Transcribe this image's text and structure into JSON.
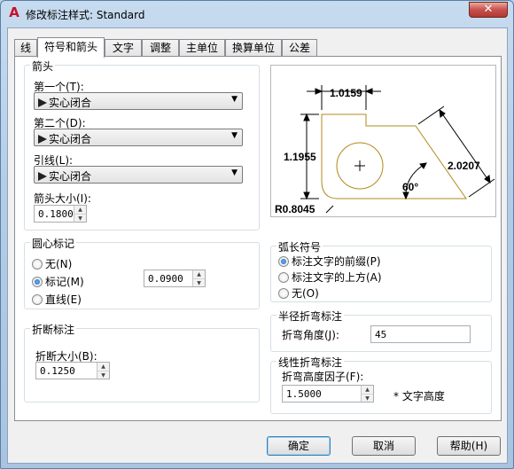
{
  "window": {
    "title": "修改标注样式: Standard",
    "close": "✕"
  },
  "tabs": [
    "线",
    "符号和箭头",
    "文字",
    "调整",
    "主单位",
    "换算单位",
    "公差"
  ],
  "arrows": {
    "legend": "箭头",
    "first_label": "第一个(T):",
    "first_value": "实心闭合",
    "second_label": "第二个(D):",
    "second_value": "实心闭合",
    "leader_label": "引线(L):",
    "leader_value": "实心闭合",
    "size_label": "箭头大小(I):",
    "size_value": "0.1800"
  },
  "center_marks": {
    "legend": "圆心标记",
    "none": "无(N)",
    "mark": "标记(M)",
    "line": "直线(E)",
    "value": "0.0900",
    "selected": "mark"
  },
  "break": {
    "legend": "折断标注",
    "size_label": "折断大小(B):",
    "size_value": "0.1250"
  },
  "arc_length": {
    "legend": "弧长符号",
    "prefix": "标注文字的前缀(P)",
    "above": "标注文字的上方(A)",
    "none": "无(O)",
    "selected": "prefix"
  },
  "radius_jog": {
    "legend": "半径折弯标注",
    "angle_label": "折弯角度(J):",
    "angle_value": "45"
  },
  "linear_jog": {
    "legend": "线性折弯标注",
    "factor_label": "折弯高度因子(F):",
    "factor_value": "1.5000",
    "unit_text": "* 文字高度"
  },
  "preview": {
    "dim_top": "1.0159",
    "dim_left": "1.1955",
    "dim_right": "2.0207",
    "angle": "60°",
    "radius": "R0.8045",
    "center": "+"
  },
  "buttons": {
    "ok": "确定",
    "cancel": "取消",
    "help": "帮助(H)"
  },
  "colors": {
    "geometry": "#b08a1a",
    "dimension": "#000000"
  }
}
